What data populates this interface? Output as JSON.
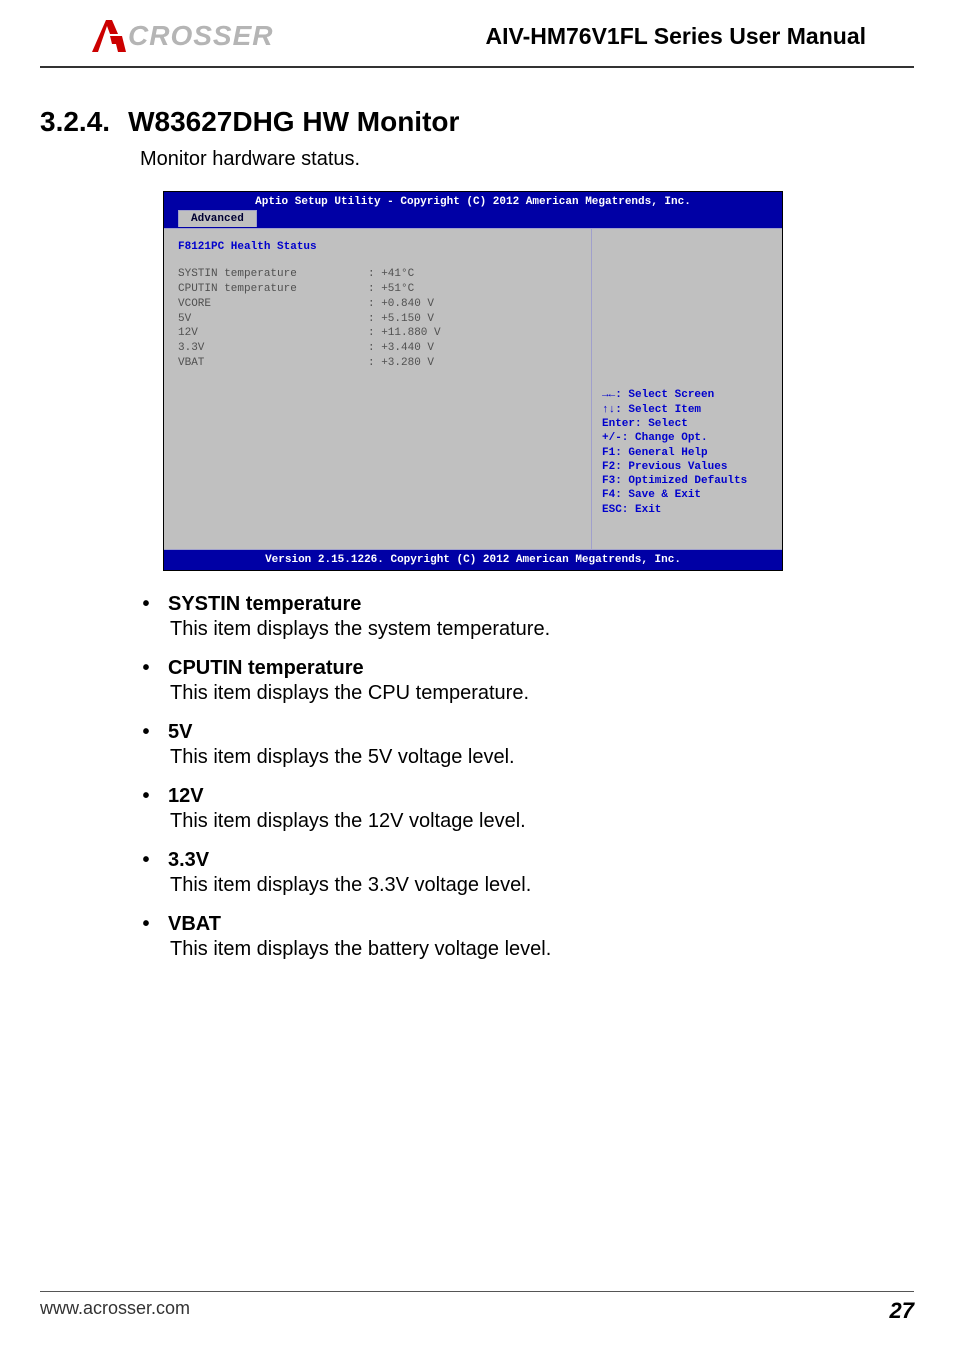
{
  "header": {
    "logo_text": "CROSSER",
    "title": "AIV-HM76V1FL Series User Manual"
  },
  "section": {
    "number": "3.2.4.",
    "title": "W83627DHG HW Monitor",
    "intro": "Monitor hardware status."
  },
  "bios": {
    "title": "Aptio Setup Utility - Copyright (C) 2012 American Megatrends, Inc.",
    "tab": "Advanced",
    "section_title": "F8121PC Health Status",
    "rows": [
      {
        "label": "SYSTIN temperature",
        "value": ": +41°C"
      },
      {
        "label": "CPUTIN temperature",
        "value": ": +51°C"
      },
      {
        "label": "VCORE",
        "value": ": +0.840 V"
      },
      {
        "label": " 5V",
        "value": ": +5.150 V"
      },
      {
        "label": "12V",
        "value": ": +11.880 V"
      },
      {
        "label": "3.3V",
        "value": ": +3.440 V"
      },
      {
        "label": "VBAT",
        "value": ": +3.280 V"
      }
    ],
    "help": [
      "→←: Select Screen",
      "↑↓: Select Item",
      "Enter: Select",
      "+/-: Change Opt.",
      "F1: General Help",
      "F2: Previous Values",
      "F3: Optimized Defaults",
      "F4: Save & Exit",
      "ESC: Exit"
    ],
    "footer": "Version 2.15.1226. Copyright (C) 2012 American Megatrends, Inc."
  },
  "bullets": [
    {
      "title": "SYSTIN temperature",
      "desc": "This item displays the system temperature."
    },
    {
      "title": "CPUTIN temperature",
      "desc": "This item displays the CPU temperature."
    },
    {
      "title": "5V",
      "desc": "This item displays the 5V voltage level."
    },
    {
      "title": "12V",
      "desc": "This item displays the 12V voltage level."
    },
    {
      "title": "3.3V",
      "desc": "This item displays the 3.3V voltage level."
    },
    {
      "title": "VBAT",
      "desc": "This item displays the battery voltage level."
    }
  ],
  "footer": {
    "url": "www.acrosser.com",
    "page": "27"
  }
}
